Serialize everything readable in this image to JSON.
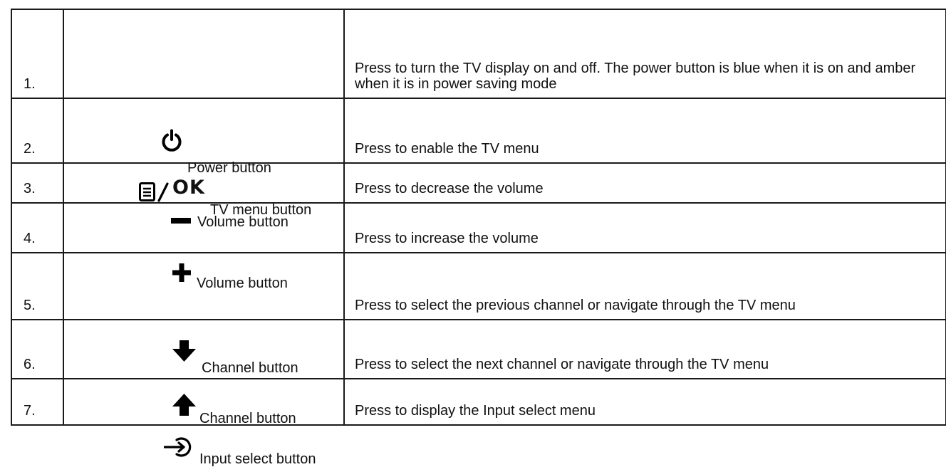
{
  "rows": [
    {
      "number": "1.",
      "label": "Power button",
      "icon": "power-icon",
      "description": "Press to turn the TV display on and off. The power button is blue when it is on and amber when it is in power saving mode"
    },
    {
      "number": "2.",
      "label": "TV menu button",
      "icon": "menu-ok-icon",
      "icon_text": "OK",
      "description": "Press to enable the TV menu"
    },
    {
      "number": "3.",
      "label": "Volume button",
      "icon": "minus-icon",
      "description": "Press to decrease the volume"
    },
    {
      "number": "4.",
      "label": "Volume button",
      "icon": "plus-icon",
      "description": "Press to increase the volume"
    },
    {
      "number": "5.",
      "label": "Channel button",
      "icon": "arrow-down-icon",
      "description": "Press to select the previous channel or navigate through the TV menu"
    },
    {
      "number": "6.",
      "label": "Channel button",
      "icon": "arrow-up-icon",
      "description": "Press to select the next channel or navigate through the TV menu"
    },
    {
      "number": "7.",
      "label": "Input select button",
      "icon": "input-select-icon",
      "description": "Press to display the Input select menu"
    }
  ]
}
